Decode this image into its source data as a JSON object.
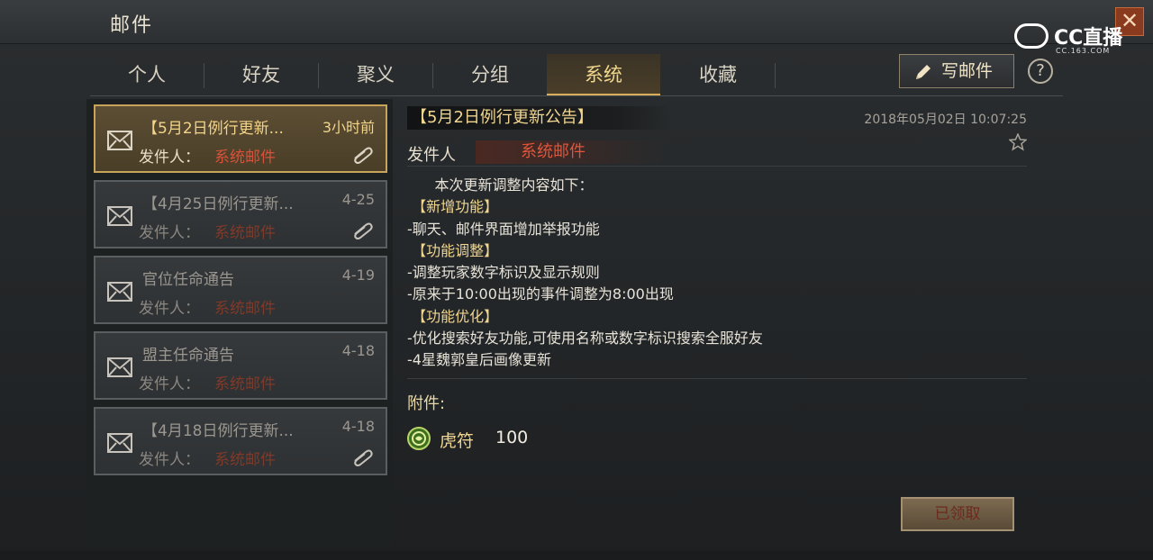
{
  "window": {
    "title": "邮件",
    "close_icon": "close-icon"
  },
  "watermark": {
    "brand": "CC直播",
    "sub": "CC.163.COM"
  },
  "tabs": [
    {
      "label": "个人",
      "active": false
    },
    {
      "label": "好友",
      "active": false
    },
    {
      "label": "聚义",
      "active": false
    },
    {
      "label": "分组",
      "active": false
    },
    {
      "label": "系统",
      "active": true
    },
    {
      "label": "收藏",
      "active": false
    }
  ],
  "toolbar": {
    "write_label": "写邮件",
    "help_label": "?"
  },
  "mails": [
    {
      "subject": "【5月2日例行更新...",
      "date": "3小时前",
      "sender_label": "发件人：",
      "sender": "系统邮件",
      "has_attachment": true,
      "selected": true
    },
    {
      "subject": "【4月25日例行更新...",
      "date": "4-25",
      "sender_label": "发件人：",
      "sender": "系统邮件",
      "has_attachment": true,
      "selected": false
    },
    {
      "subject": "官位任命通告",
      "date": "4-19",
      "sender_label": "发件人：",
      "sender": "系统邮件",
      "has_attachment": false,
      "selected": false
    },
    {
      "subject": "盟主任命通告",
      "date": "4-18",
      "sender_label": "发件人：",
      "sender": "系统邮件",
      "has_attachment": false,
      "selected": false
    },
    {
      "subject": "【4月18日例行更新...",
      "date": "4-18",
      "sender_label": "发件人：",
      "sender": "系统邮件",
      "has_attachment": true,
      "selected": false
    }
  ],
  "detail": {
    "title": "【5月2日例行更新公告】",
    "timestamp": "2018年05月02日 10:07:25",
    "sender_label": "发件人",
    "sender": "系统邮件",
    "body": [
      {
        "text": "      本次更新调整内容如下：",
        "highlight": false
      },
      {
        "text": " 【新增功能】",
        "highlight": true
      },
      {
        "text": "-聊天、邮件界面增加举报功能",
        "highlight": false
      },
      {
        "text": " 【功能调整】",
        "highlight": true
      },
      {
        "text": "-调整玩家数字标识及显示规则",
        "highlight": false
      },
      {
        "text": "-原来于10:00出现的事件调整为8:00出现",
        "highlight": false
      },
      {
        "text": " 【功能优化】",
        "highlight": true
      },
      {
        "text": "-优化搜索好友功能,可使用名称或数字标识搜索全服好友",
        "highlight": false
      },
      {
        "text": "-4星魏郭皇后画像更新",
        "highlight": false
      }
    ],
    "attachment_label": "附件:",
    "attachment": {
      "icon": "tiger-token-icon",
      "name": "虎符",
      "quantity": "100"
    },
    "claimed_label": "已领取"
  }
}
